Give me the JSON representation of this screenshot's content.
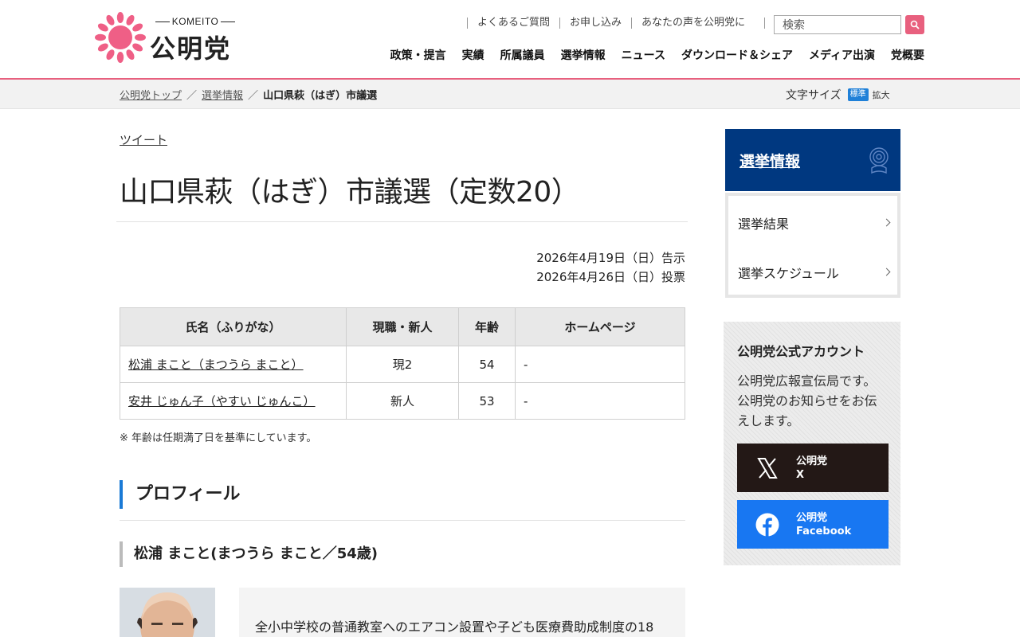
{
  "header": {
    "logo_en": "KOMEITO",
    "logo_jp": "公明党",
    "util_links": [
      "よくあるご質問",
      "お申し込み",
      "あなたの声を公明党に"
    ],
    "search_placeholder": "検索",
    "nav": [
      "政策・提言",
      "実績",
      "所属議員",
      "選挙情報",
      "ニュース",
      "ダウンロード＆シェア",
      "メディア出演",
      "党概要"
    ]
  },
  "breadcrumb": {
    "items": [
      "公明党トップ",
      "選挙情報"
    ],
    "current": "山口県萩（はぎ）市議選",
    "separator": "／"
  },
  "font_size": {
    "label": "文字サイズ",
    "standard": "標準",
    "large": "拡大"
  },
  "main": {
    "tweet": "ツイート",
    "title": "山口県萩（はぎ）市議選（定数20）",
    "dates": [
      "2026年4月19日（日）告示",
      "2026年4月26日（日）投票"
    ],
    "table": {
      "headers": [
        "氏名（ふりがな）",
        "現職・新人",
        "年齢",
        "ホームページ"
      ],
      "rows": [
        [
          "松浦 まこと（まつうら まこと）",
          "現2",
          "54",
          "-"
        ],
        [
          "安井 じゅん子（やすい じゅんこ）",
          "新人",
          "53",
          "-"
        ]
      ]
    },
    "note": "※ 年齢は任期満了日を基準にしています。",
    "profile_heading": "プロフィール",
    "profile_name": "松浦 まこと(まつうら まこと／54歳)",
    "profile_text": "全小中学校の普通教室へのエアコン設置や子ども医療費助成制度の18"
  },
  "sidebar": {
    "title": "選挙情報",
    "items": [
      "選挙結果",
      "選挙スケジュール"
    ],
    "account": {
      "title": "公明党公式アカウント",
      "desc": "公明党広報宣伝局です。公明党のお知らせをお伝えします。",
      "x_line1": "公明党",
      "x_line2": "X",
      "fb_line1": "公明党",
      "fb_line2": "Facebook"
    }
  },
  "colors": {
    "brand_pink": "#e8607e",
    "navy": "#003880",
    "accent_blue": "#1a7ad6",
    "facebook": "#1877f2",
    "x_black": "#231816"
  },
  "icons": [
    "komeito-sun-logo",
    "search-icon",
    "rose-emblem-icon",
    "chevron-right-icon",
    "x-logo-icon",
    "facebook-logo-icon"
  ]
}
